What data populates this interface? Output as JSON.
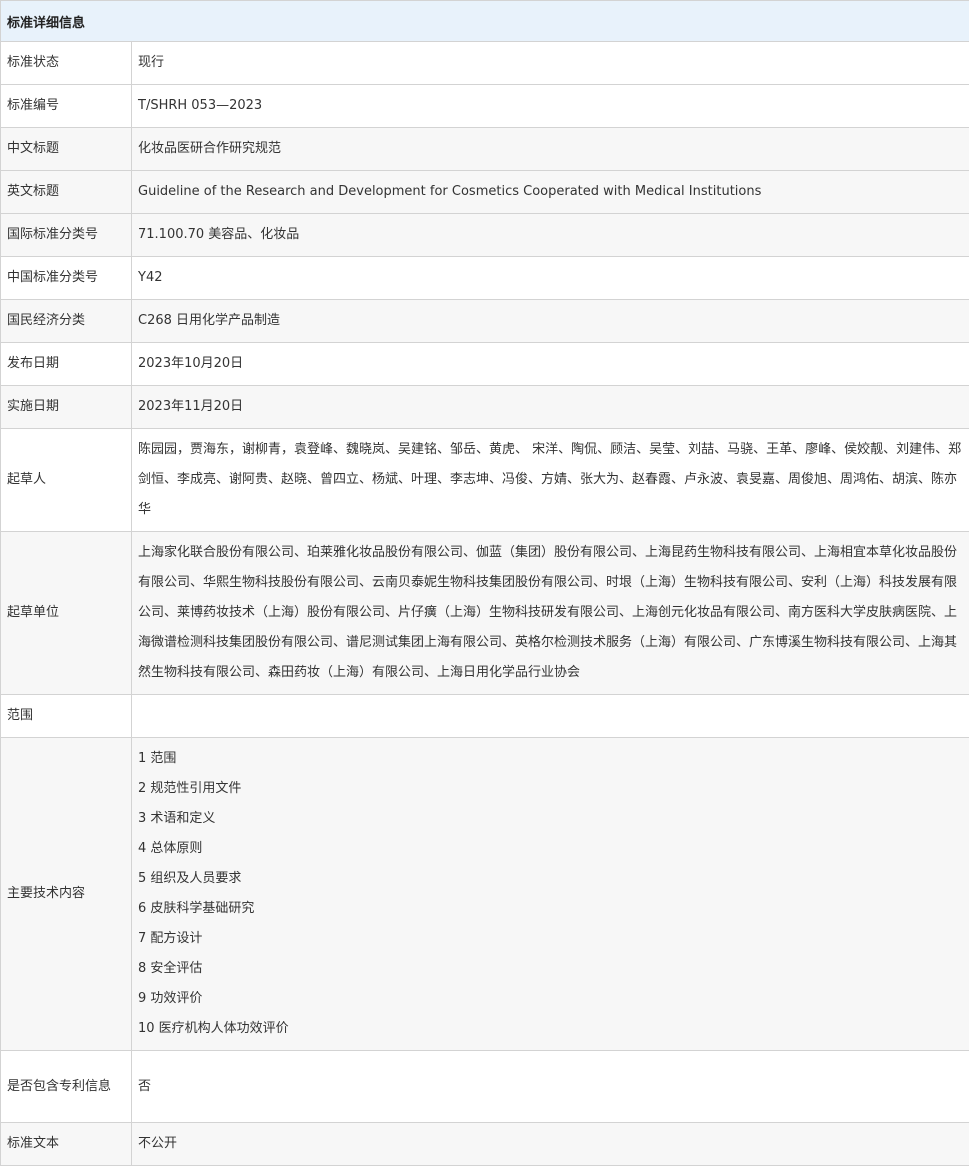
{
  "header": {
    "title": "标准详细信息"
  },
  "rows": [
    {
      "label": "标准状态",
      "value": "现行"
    },
    {
      "label": "标准编号",
      "value": "T/SHRH 053—2023"
    },
    {
      "label": "中文标题",
      "value": "化妆品医研合作研究规范"
    },
    {
      "label": "英文标题",
      "value": "Guideline of the Research and Development for Cosmetics Cooperated with Medical Institutions"
    },
    {
      "label": "国际标准分类号",
      "value": "71.100.70 美容品、化妆品"
    },
    {
      "label": "中国标准分类号",
      "value": "Y42"
    },
    {
      "label": "国民经济分类",
      "value": "C268 日用化学产品制造"
    },
    {
      "label": "发布日期",
      "value": "2023年10月20日"
    },
    {
      "label": "实施日期",
      "value": "2023年11月20日"
    }
  ],
  "drafters": {
    "label": "起草人",
    "value": "陈园园，贾海东，谢柳青，袁登峰、魏晓岚、吴建铭、邹岳、黄虎、 宋洋、陶侃、顾洁、吴莹、刘喆、马骁、王革、廖峰、侯姣靓、刘建伟、郑剑恒、李成亮、谢阿贵、赵晓、曾四立、杨斌、叶理、李志坤、冯俊、方婧、张大为、赵春霞、卢永波、袁旻嘉、周俊旭、周鸿佑、胡滨、陈亦华"
  },
  "drafting_units": {
    "label": "起草单位",
    "value": "上海家化联合股份有限公司、珀莱雅化妆品股份有限公司、伽蓝（集团）股份有限公司、上海昆药生物科技有限公司、上海相宜本草化妆品股份有限公司、华熙生物科技股份有限公司、云南贝泰妮生物科技集团股份有限公司、时垠（上海）生物科技有限公司、安利（上海）科技发展有限公司、莱博药妆技术（上海）股份有限公司、片仔癀（上海）生物科技研发有限公司、上海创元化妆品有限公司、南方医科大学皮肤病医院、上海微谱检测科技集团股份有限公司、谱尼测试集团上海有限公司、英格尔检测技术服务（上海）有限公司、广东博溪生物科技有限公司、上海其然生物科技有限公司、森田药妆（上海）有限公司、上海日用化学品行业协会"
  },
  "scope": {
    "label": "范围",
    "value": ""
  },
  "main_content": {
    "label": "主要技术内容",
    "items": [
      "1 范围",
      "2 规范性引用文件",
      "3 术语和定义",
      "4 总体原则",
      "5 组织及人员要求",
      "6 皮肤科学基础研究",
      "7 配方设计",
      "8 安全评估",
      "9 功效评价",
      "10 医疗机构人体功效评价"
    ]
  },
  "patent": {
    "label": "是否包含专利信息",
    "value": "否"
  },
  "text": {
    "label": "标准文本",
    "value": "不公开"
  }
}
